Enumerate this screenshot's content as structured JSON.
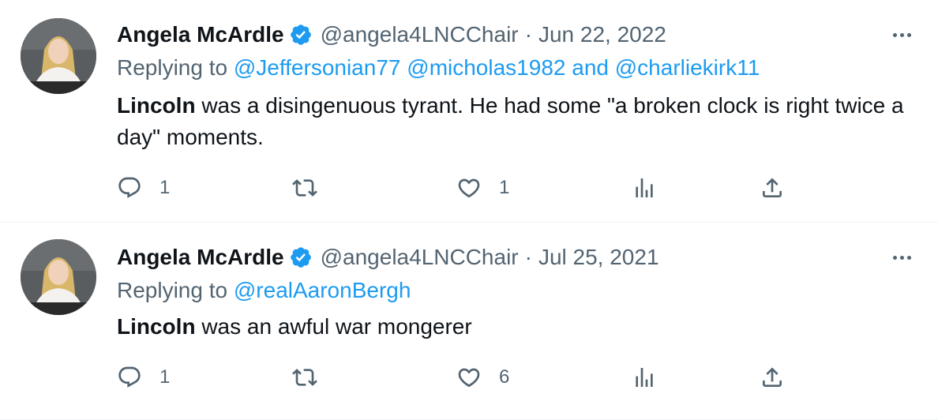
{
  "tweets": [
    {
      "author": {
        "name": "Angela McArdle",
        "handle": "@angela4LNCChair"
      },
      "date": "Jun 22, 2022",
      "separator": "·",
      "replying_prefix": "Replying to",
      "replying_handles": [
        "@Jeffersonian77",
        "@micholas1982"
      ],
      "replying_conjunction": "and",
      "replying_last": "@charliekirk11",
      "body_bold": "Lincoln",
      "body_rest": " was a disingenuous tyrant. He had some \"a broken clock is right twice a day\" moments.",
      "stats": {
        "replies": "1",
        "retweets": "",
        "likes": "1"
      }
    },
    {
      "author": {
        "name": "Angela McArdle",
        "handle": "@angela4LNCChair"
      },
      "date": "Jul 25, 2021",
      "separator": "·",
      "replying_prefix": "Replying to",
      "replying_handles": [
        "@realAaronBergh"
      ],
      "replying_conjunction": "",
      "replying_last": "",
      "body_bold": "Lincoln",
      "body_rest": " was an awful war mongerer",
      "stats": {
        "replies": "1",
        "retweets": "",
        "likes": "6"
      }
    }
  ],
  "icons": {
    "verified": "verified-badge-icon",
    "more": "more-dots-icon",
    "reply": "reply-bubble-icon",
    "retweet": "retweet-icon",
    "like": "heart-icon",
    "views": "views-bar-icon",
    "share": "share-upload-icon"
  },
  "colors": {
    "link": "#1d9bf0",
    "muted": "#536471",
    "text": "#0f1419",
    "divider": "#eff3f4"
  }
}
